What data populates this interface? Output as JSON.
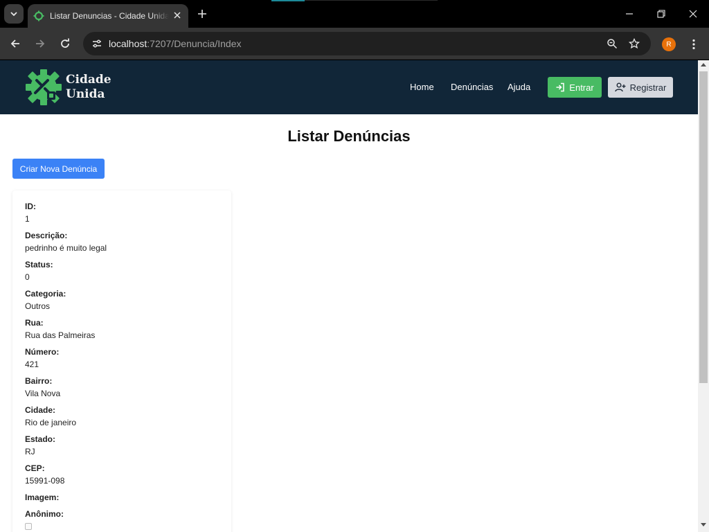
{
  "browser": {
    "tab_title": "Listar Denuncias - Cidade Unida",
    "url_host": "localhost",
    "url_path": ":7207/Denuncia/Index",
    "profile_initial": "R"
  },
  "site": {
    "logo_line1": "Cidade",
    "logo_line2": "Unida",
    "nav": [
      "Home",
      "Denúncias",
      "Ajuda"
    ],
    "login_label": "Entrar",
    "register_label": "Registrar",
    "colors": {
      "header_bg": "#112638",
      "logo_green": "#48bb63",
      "login_bg": "#48bb63",
      "register_bg": "#d5d8de",
      "primary_blue": "#3b82f6"
    }
  },
  "page": {
    "title": "Listar Denúncias",
    "create_button": "Criar Nova Denúncia"
  },
  "denuncia": {
    "fields": [
      {
        "label": "ID:",
        "value": "1"
      },
      {
        "label": "Descrição:",
        "value": "pedrinho é muito legal"
      },
      {
        "label": "Status:",
        "value": "0"
      },
      {
        "label": "Categoria:",
        "value": "Outros"
      },
      {
        "label": "Rua:",
        "value": "Rua das Palmeiras"
      },
      {
        "label": "Número:",
        "value": "421"
      },
      {
        "label": "Bairro:",
        "value": "Vila Nova"
      },
      {
        "label": "Cidade:",
        "value": "Rio de janeiro"
      },
      {
        "label": "Estado:",
        "value": "RJ"
      },
      {
        "label": "CEP:",
        "value": "15991-098"
      }
    ],
    "image_label": "Imagem:",
    "anonymous_label": "Anônimo:",
    "anonymous_checked": false
  }
}
